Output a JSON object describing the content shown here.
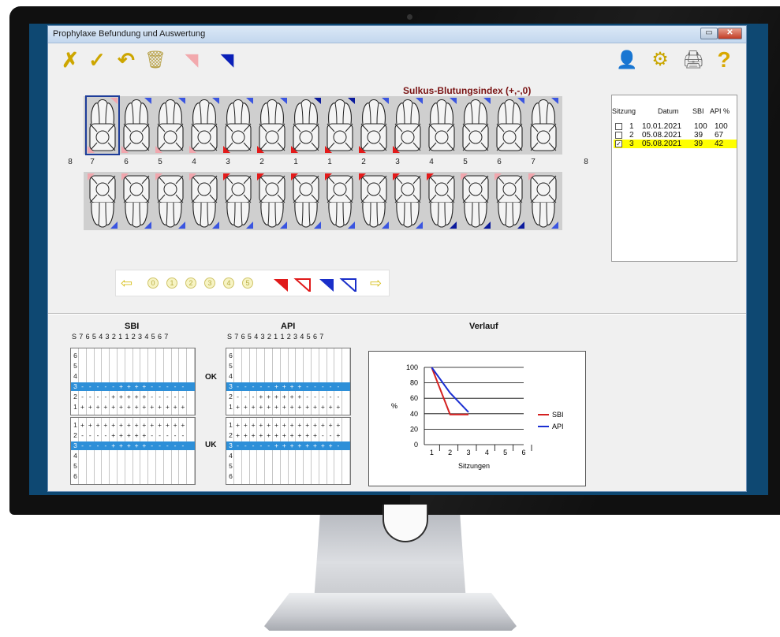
{
  "window": {
    "title": "Prophylaxe Befundung und Auswertung",
    "minimize_glyph": "▭",
    "close_glyph": "✕"
  },
  "toolbar": {
    "cancel_icon": "✗",
    "ok_icon": "✓",
    "undo_icon": "↶",
    "delete_icon": "🗑",
    "pink_marker_icon": "◥",
    "blue_marker_icon": "◥",
    "patient_icon": "👤",
    "settings_icon": "⚙",
    "print_icon": "🖨",
    "help_icon": "?"
  },
  "teeth": {
    "title": "Sulkus-Blutungsindex (+,-,0)",
    "numbers": [
      "8",
      "7",
      "6",
      "5",
      "4",
      "3",
      "2",
      "1",
      "1",
      "2",
      "3",
      "4",
      "5",
      "6",
      "7",
      "8"
    ],
    "upper_marks": [
      "pink",
      "blue",
      "blue",
      "blue",
      "blue",
      "blue",
      "navy",
      "navy",
      "blue",
      "blue",
      "blue",
      "blue",
      "blue",
      "blue"
    ],
    "upper_bottom_marks": [
      "pink",
      "pink",
      "pink",
      "pink",
      "red",
      "red",
      "red",
      "red",
      "red",
      "red",
      "none",
      "none",
      "none",
      "none"
    ],
    "lower_top_marks": [
      "pink",
      "pink",
      "pink",
      "pink",
      "red",
      "red",
      "red",
      "red",
      "red",
      "red",
      "red",
      "pink",
      "pink",
      "pink"
    ],
    "lower_bottom_marks": [
      "blue",
      "blue",
      "blue",
      "blue",
      "blue",
      "blue",
      "blue",
      "blue",
      "blue",
      "blue",
      "navy",
      "navy",
      "navy",
      "blue"
    ]
  },
  "legend_bar": {
    "left_arrow": "⇦",
    "circles": [
      "0",
      "1",
      "2",
      "3",
      "4",
      "5"
    ],
    "right_arrow": "⇨",
    "marker_colors": {
      "red": "#e01a1a",
      "blue": "#1a2fc9"
    }
  },
  "sessions": {
    "headers": [
      "Sitzung",
      "Datum",
      "SBI",
      "API %"
    ],
    "rows": [
      {
        "check": "",
        "nr": "1",
        "date": "10.01.2021",
        "sbi": "100",
        "api": "100",
        "highlight": false
      },
      {
        "check": "",
        "nr": "2",
        "date": "05.08.2021",
        "sbi": "39",
        "api": "67",
        "highlight": false
      },
      {
        "check": "✓",
        "nr": "3",
        "date": "05.08.2021",
        "sbi": "39",
        "api": "42",
        "highlight": true
      }
    ]
  },
  "sbi_grid": {
    "title": "SBI",
    "header": "S 7 6 5 4 3 2 1  1 2 3 4 5 6 7",
    "ok_rows": [
      {
        "label": "6",
        "cells": [
          "",
          "",
          "",
          "",
          "",
          "",
          "",
          "",
          "",
          "",
          "",
          "",
          "",
          "",
          ""
        ],
        "hl": false
      },
      {
        "label": "5",
        "cells": [
          "",
          "",
          "",
          "",
          "",
          "",
          "",
          "",
          "",
          "",
          "",
          "",
          "",
          "",
          ""
        ],
        "hl": false
      },
      {
        "label": "4",
        "cells": [
          "",
          "",
          "",
          "",
          "",
          "",
          "",
          "",
          "",
          "",
          "",
          "",
          "",
          "",
          ""
        ],
        "hl": false
      },
      {
        "label": "3",
        "cells": [
          "-",
          "-",
          "-",
          "-",
          "-",
          "+",
          "+",
          "+",
          "+",
          "-",
          "-",
          "-",
          "-",
          "-",
          ""
        ],
        "hl": true
      },
      {
        "label": "2",
        "cells": [
          "-",
          "-",
          "-",
          "-",
          "+",
          "+",
          "+",
          "+",
          "+",
          "-",
          "-",
          "-",
          "-",
          "-",
          ""
        ],
        "hl": false
      },
      {
        "label": "1",
        "cells": [
          "+",
          "+",
          "+",
          "+",
          "+",
          "+",
          "+",
          "+",
          "+",
          "+",
          "+",
          "+",
          "+",
          "+",
          ""
        ],
        "hl": false
      }
    ],
    "uk_rows": [
      {
        "label": "1",
        "cells": [
          "+",
          "+",
          "+",
          "+",
          "+",
          "+",
          "+",
          "+",
          "+",
          "+",
          "+",
          "+",
          "+",
          "+",
          ""
        ],
        "hl": false
      },
      {
        "label": "2",
        "cells": [
          "-",
          "-",
          "-",
          "-",
          "+",
          "+",
          "+",
          "+",
          "+",
          "-",
          "-",
          "-",
          "-",
          "-",
          ""
        ],
        "hl": false
      },
      {
        "label": "3",
        "cells": [
          "-",
          "-",
          "-",
          "-",
          "+",
          "+",
          "+",
          "+",
          "+",
          "-",
          "-",
          "-",
          "-",
          "-",
          ""
        ],
        "hl": true
      },
      {
        "label": "4",
        "cells": [
          "",
          "",
          "",
          "",
          "",
          "",
          "",
          "",
          "",
          "",
          "",
          "",
          "",
          "",
          ""
        ],
        "hl": false
      },
      {
        "label": "5",
        "cells": [
          "",
          "",
          "",
          "",
          "",
          "",
          "",
          "",
          "",
          "",
          "",
          "",
          "",
          "",
          ""
        ],
        "hl": false
      },
      {
        "label": "6",
        "cells": [
          "",
          "",
          "",
          "",
          "",
          "",
          "",
          "",
          "",
          "",
          "",
          "",
          "",
          "",
          ""
        ],
        "hl": false
      }
    ]
  },
  "api_grid": {
    "title": "API",
    "header": "S 7 6 5 4 3 2 1  1 2 3 4 5 6 7",
    "ok_rows": [
      {
        "label": "6",
        "cells": [
          "",
          "",
          "",
          "",
          "",
          "",
          "",
          "",
          "",
          "",
          "",
          "",
          "",
          "",
          ""
        ],
        "hl": false
      },
      {
        "label": "5",
        "cells": [
          "",
          "",
          "",
          "",
          "",
          "",
          "",
          "",
          "",
          "",
          "",
          "",
          "",
          "",
          ""
        ],
        "hl": false
      },
      {
        "label": "4",
        "cells": [
          "",
          "",
          "",
          "",
          "",
          "",
          "",
          "",
          "",
          "",
          "",
          "",
          "",
          "",
          ""
        ],
        "hl": false
      },
      {
        "label": "3",
        "cells": [
          "-",
          "-",
          "-",
          "-",
          "-",
          "+",
          "+",
          "+",
          "+",
          "-",
          "-",
          "-",
          "-",
          "-",
          ""
        ],
        "hl": true
      },
      {
        "label": "2",
        "cells": [
          "-",
          "-",
          "-",
          "+",
          "+",
          "+",
          "+",
          "+",
          "+",
          "-",
          "-",
          "-",
          "-",
          "-",
          ""
        ],
        "hl": false
      },
      {
        "label": "1",
        "cells": [
          "+",
          "+",
          "+",
          "+",
          "+",
          "+",
          "+",
          "+",
          "+",
          "+",
          "+",
          "+",
          "+",
          "+",
          ""
        ],
        "hl": false
      }
    ],
    "uk_rows": [
      {
        "label": "1",
        "cells": [
          "+",
          "+",
          "+",
          "+",
          "+",
          "+",
          "+",
          "+",
          "+",
          "+",
          "+",
          "+",
          "+",
          "+",
          ""
        ],
        "hl": false
      },
      {
        "label": "2",
        "cells": [
          "+",
          "+",
          "+",
          "+",
          "+",
          "+",
          "+",
          "+",
          "+",
          "+",
          "+",
          "-",
          "-",
          "+",
          ""
        ],
        "hl": false
      },
      {
        "label": "3",
        "cells": [
          "-",
          "-",
          "-",
          "-",
          "-",
          "+",
          "+",
          "+",
          "+",
          "+",
          "+",
          "+",
          "+",
          "-",
          ""
        ],
        "hl": true
      },
      {
        "label": "4",
        "cells": [
          "",
          "",
          "",
          "",
          "",
          "",
          "",
          "",
          "",
          "",
          "",
          "",
          "",
          "",
          ""
        ],
        "hl": false
      },
      {
        "label": "5",
        "cells": [
          "",
          "",
          "",
          "",
          "",
          "",
          "",
          "",
          "",
          "",
          "",
          "",
          "",
          "",
          ""
        ],
        "hl": false
      },
      {
        "label": "6",
        "cells": [
          "",
          "",
          "",
          "",
          "",
          "",
          "",
          "",
          "",
          "",
          "",
          "",
          "",
          "",
          ""
        ],
        "hl": false
      }
    ]
  },
  "jaw_labels": {
    "ok": "OK",
    "uk": "UK"
  },
  "chart_data": {
    "type": "line",
    "title": "Verlauf",
    "xlabel": "Sitzungen",
    "ylabel": "%",
    "x": [
      1,
      2,
      3,
      4,
      5,
      6
    ],
    "ylim": [
      0,
      100
    ],
    "yticks": [
      0,
      20,
      40,
      60,
      80,
      100
    ],
    "series": [
      {
        "name": "SBI",
        "color": "#d42020",
        "points": [
          [
            1,
            100
          ],
          [
            2,
            39
          ],
          [
            3,
            39
          ]
        ]
      },
      {
        "name": "API",
        "color": "#1b2fd2",
        "points": [
          [
            1,
            100
          ],
          [
            2,
            67
          ],
          [
            3,
            42
          ]
        ]
      }
    ],
    "legend": "right"
  }
}
